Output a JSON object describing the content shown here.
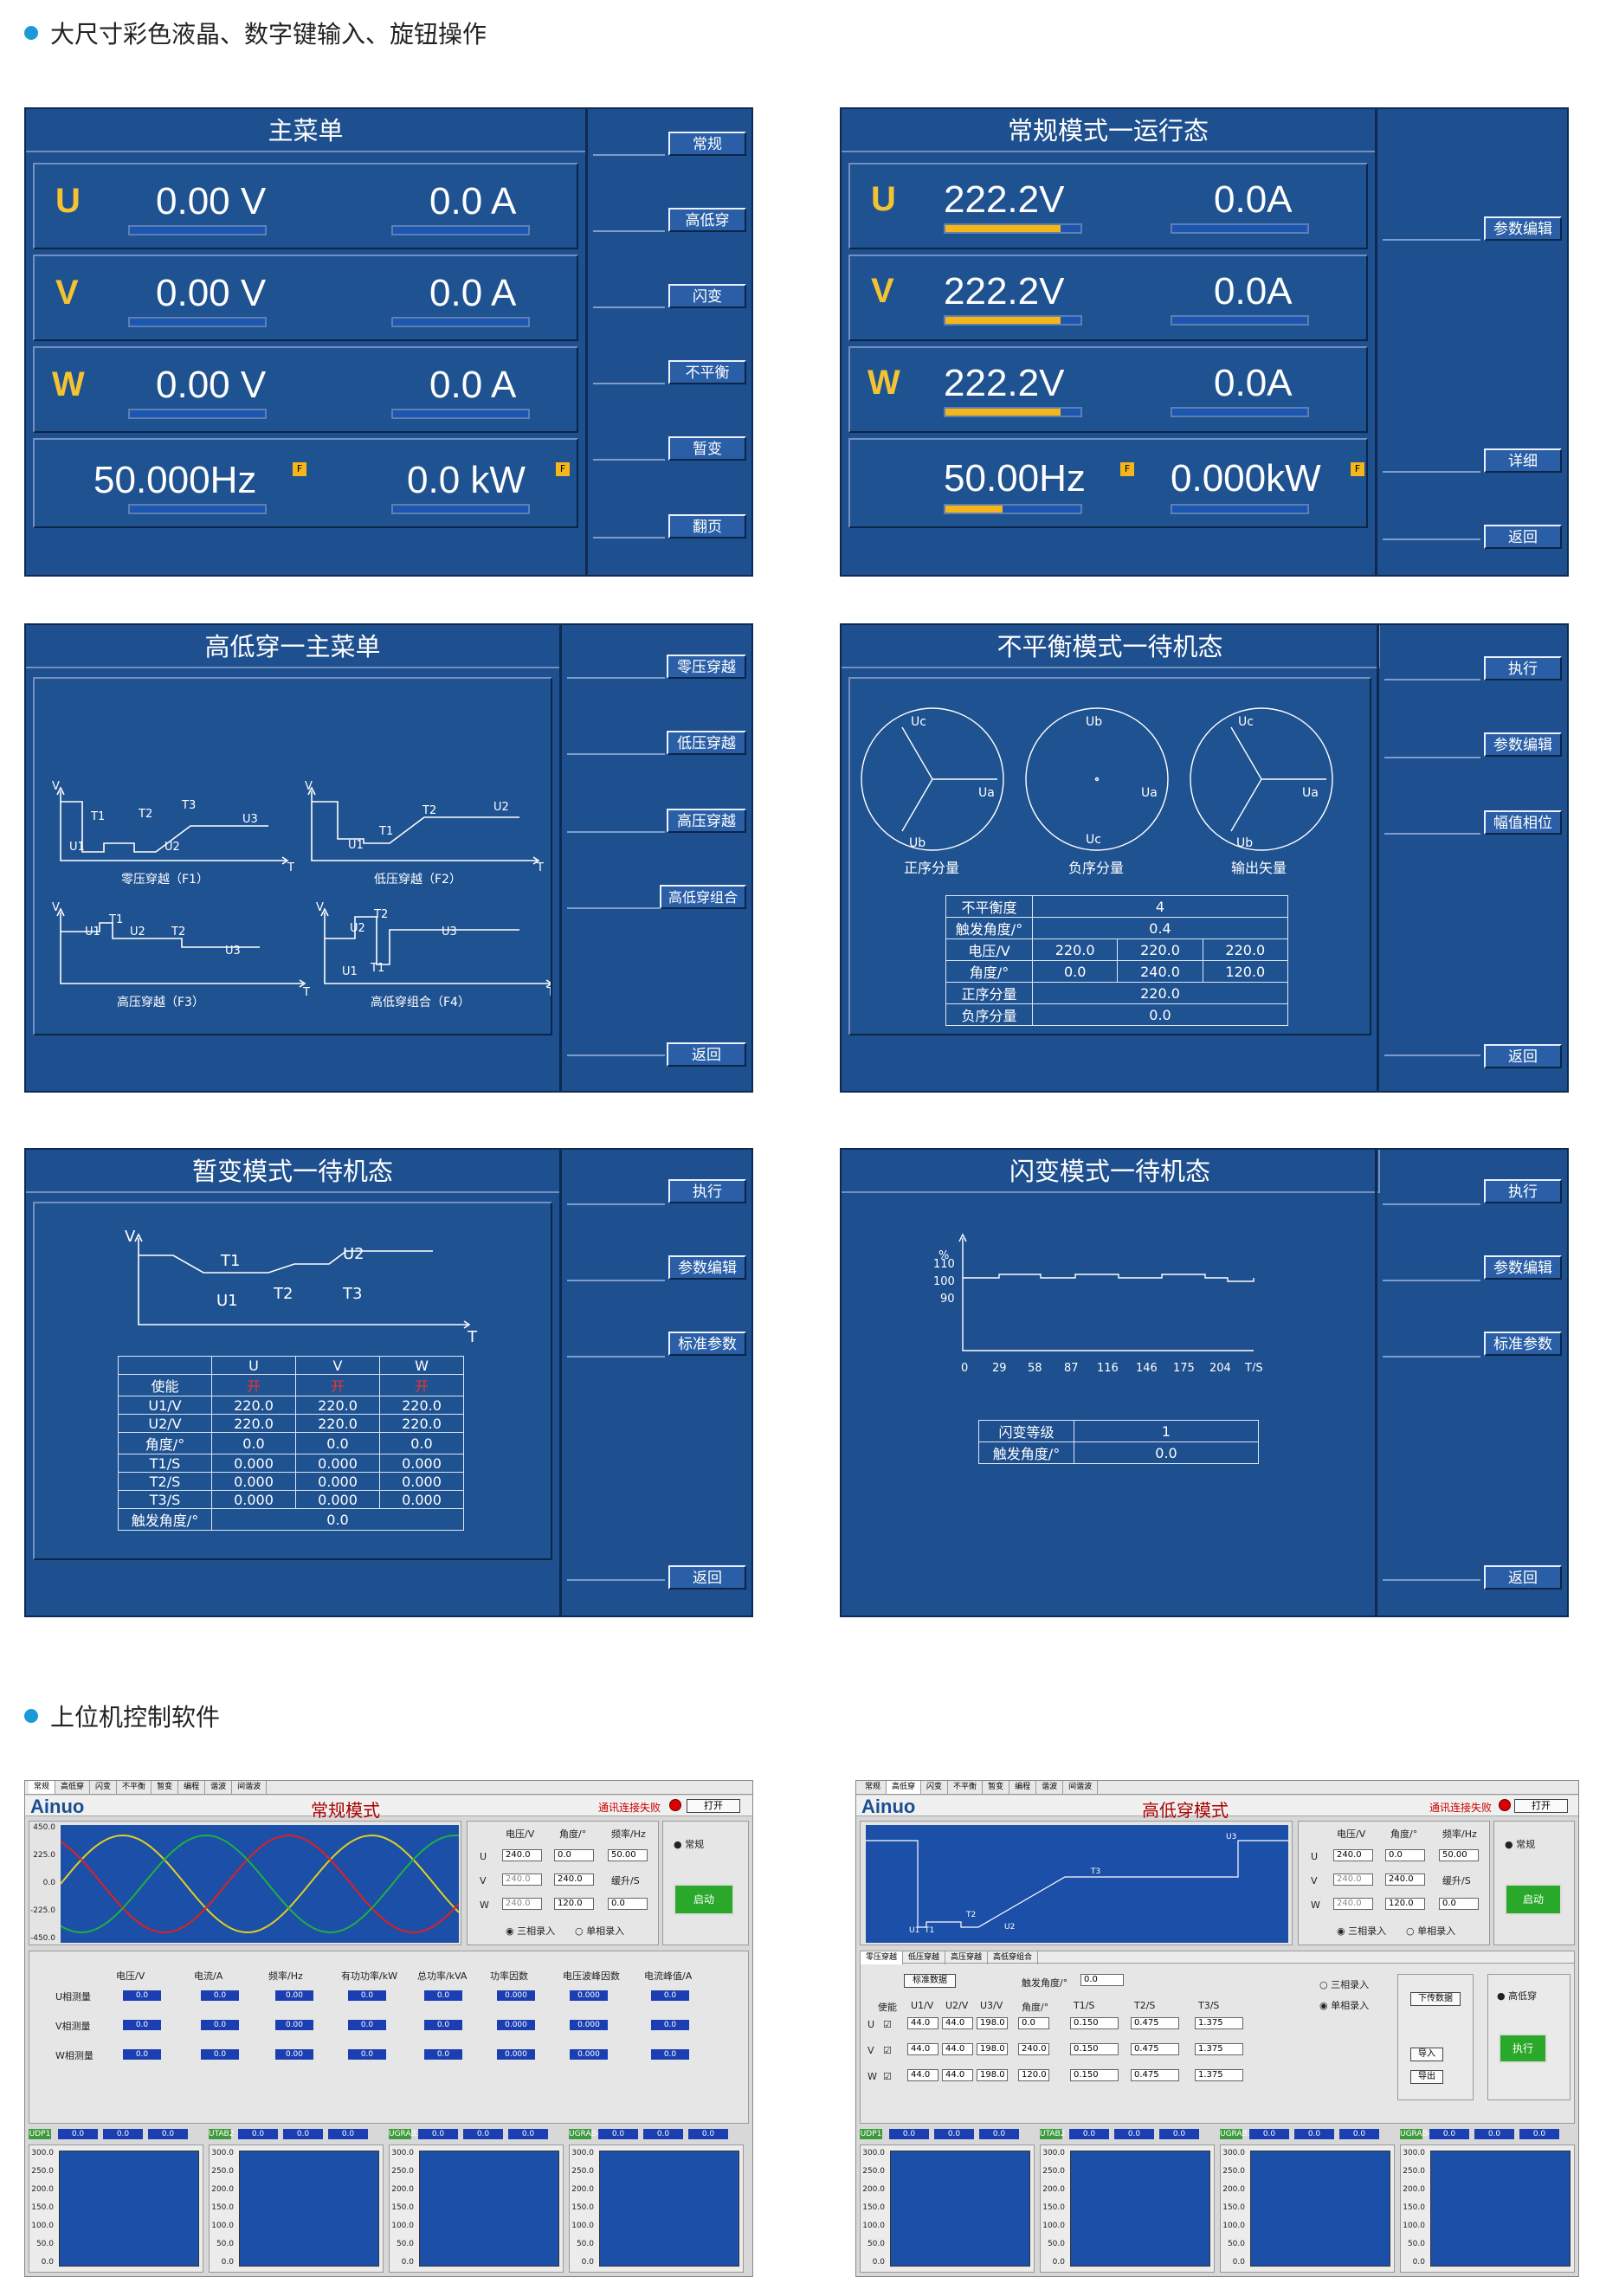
{
  "sections": {
    "s1": "大尺寸彩色液晶、数字键输入、旋钮操作",
    "s2": "上位机控制软件"
  },
  "p1": {
    "title": "主菜单",
    "buttons": [
      "常规",
      "高低穿",
      "闪变",
      "不平衡",
      "暂变",
      "翻页"
    ],
    "rows": [
      {
        "ph": "U",
        "v": "0.00 V",
        "a": "0.0 A"
      },
      {
        "ph": "V",
        "v": "0.00 V",
        "a": "0.0 A"
      },
      {
        "ph": "W",
        "v": "0.00 V",
        "a": "0.0 A"
      }
    ],
    "freq": "50.000Hz",
    "power": "0.0 kW",
    "badge": "F"
  },
  "p2": {
    "title": "常规模式一运行态",
    "buttons": [
      "参数编辑",
      "详细",
      "返回"
    ],
    "rows": [
      {
        "ph": "U",
        "v": "222.2V",
        "a": "0.0A",
        "fill": 0.85
      },
      {
        "ph": "V",
        "v": "222.2V",
        "a": "0.0A",
        "fill": 0.85
      },
      {
        "ph": "W",
        "v": "222.2V",
        "a": "0.0A",
        "fill": 0.85
      }
    ],
    "freq": "50.00Hz",
    "power": "0.000kW",
    "badge": "F",
    "freq_fill": 0.42
  },
  "p3": {
    "title": "高低穿一主菜单",
    "buttons": [
      "零压穿越",
      "低压穿越",
      "高压穿越",
      "高低穿组合",
      "返回"
    ],
    "captions": [
      "零压穿越（F1）",
      "低压穿越（F2）",
      "高压穿越（F3）",
      "高低穿组合（F4）"
    ],
    "labels": {
      "V": "V",
      "T": "T",
      "U1": "U1",
      "U2": "U2",
      "U3": "U3",
      "T1": "T1",
      "T2": "T2",
      "T3": "T3"
    }
  },
  "p4": {
    "title": "不平衡模式一待机态",
    "buttons": [
      "执行",
      "参数编辑",
      "幅值相位",
      "返回"
    ],
    "phasors": [
      {
        "top": "Uc",
        "right": "Ua",
        "bottom": "Ub",
        "caption": "正序分量"
      },
      {
        "top": "Ub",
        "right": "Ua",
        "bottom": "Uc",
        "caption": "负序分量"
      },
      {
        "top": "Uc",
        "right": "Ua",
        "bottom": "Ub",
        "caption": "输出矢量"
      }
    ],
    "table": [
      [
        "不平衡度",
        "4"
      ],
      [
        "触发角度/°",
        "0.4"
      ],
      [
        "电压/V",
        "220.0",
        "220.0",
        "220.0"
      ],
      [
        "角度/°",
        "0.0",
        "240.0",
        "120.0"
      ],
      [
        "正序分量",
        "220.0"
      ],
      [
        "负序分量",
        "0.0"
      ]
    ]
  },
  "p5": {
    "title": "暂变模式一待机态",
    "buttons": [
      "执行",
      "参数编辑",
      "标准参数",
      "返回"
    ],
    "labels": {
      "V": "V",
      "T": "T",
      "T1": "T1",
      "T2": "T2",
      "T3": "T3",
      "U1": "U1",
      "U2": "U2"
    },
    "head": [
      "",
      "U",
      "V",
      "W"
    ],
    "rows": [
      [
        "使能",
        "开",
        "开",
        "开"
      ],
      [
        "U1/V",
        "220.0",
        "220.0",
        "220.0"
      ],
      [
        "U2/V",
        "220.0",
        "220.0",
        "220.0"
      ],
      [
        "角度/°",
        "0.0",
        "0.0",
        "0.0"
      ],
      [
        "T1/S",
        "0.000",
        "0.000",
        "0.000"
      ],
      [
        "T2/S",
        "0.000",
        "0.000",
        "0.000"
      ],
      [
        "T3/S",
        "0.000",
        "0.000",
        "0.000"
      ]
    ],
    "last": [
      "触发角度/°",
      "0.0"
    ]
  },
  "p6": {
    "title": "闪变模式一待机态",
    "buttons": [
      "执行",
      "参数编辑",
      "标准参数",
      "返回"
    ],
    "y_ticks": [
      "%",
      "110",
      "100",
      "90"
    ],
    "x_ticks": [
      "0",
      "29",
      "58",
      "87",
      "116",
      "146",
      "175",
      "204",
      "T/S"
    ],
    "table": [
      [
        "闪变等级",
        "1"
      ],
      [
        "触发角度/°",
        "0.0"
      ]
    ]
  },
  "w1": {
    "tabs": [
      "常规",
      "高低穿",
      "闪变",
      "不平衡",
      "暂变",
      "编程",
      "谐波",
      "间谐波"
    ],
    "logo": "Ainuo",
    "title": "常规模式",
    "status": "通讯连接失败",
    "open": "打开",
    "y_ticks": [
      "450.0",
      "225.0",
      "0.0",
      "-225.0",
      "-450.0"
    ],
    "hdr": [
      "电压/V",
      "角度/°",
      "频率/Hz"
    ],
    "ctrl": [
      {
        "ph": "U",
        "v": "240.0",
        "a": "0.0",
        "f": "50.00"
      },
      {
        "ph": "V",
        "v": "240.0",
        "a": "240.0",
        "f_lbl": "缓升/S"
      },
      {
        "ph": "W",
        "v": "240.0",
        "a": "120.0",
        "f": "0.0"
      }
    ],
    "radio": [
      "三相录入",
      "单相录入"
    ],
    "mode": "常规",
    "start": "启动",
    "meas_head": [
      "电压/V",
      "电流/A",
      "频率/Hz",
      "有功功率/kW",
      "总功率/kVA",
      "功率因数",
      "电压波峰因数",
      "电流峰值/A"
    ],
    "meas_rows": [
      "U相测量",
      "V相测量",
      "W相测量"
    ],
    "meas_vals": [
      "0.0",
      "0.0",
      "0.00",
      "0.0",
      "0.0",
      "0.000",
      "0.000",
      "0.0"
    ],
    "strip": [
      "0.0",
      "0.0",
      "0.0",
      "0.0"
    ],
    "strip_tags": [
      "UDP1",
      "UTAB2",
      "UGRAB3",
      "UGRAB4"
    ],
    "plot_ticks": [
      "300.0",
      "250.0",
      "200.0",
      "150.0",
      "100.0",
      "50.0",
      "0.0"
    ]
  },
  "w2": {
    "tabs": [
      "常规",
      "高低穿",
      "闪变",
      "不平衡",
      "暂变",
      "编程",
      "谐波",
      "间谐波"
    ],
    "logo": "Ainuo",
    "title": "高低穿模式",
    "status": "通讯连接失败",
    "open": "打开",
    "hdr": [
      "电压/V",
      "角度/°",
      "频率/Hz"
    ],
    "ctrl": [
      {
        "ph": "U",
        "v": "240.0",
        "a": "0.0",
        "f": "50.00"
      },
      {
        "ph": "V",
        "v": "240.0",
        "a": "240.0",
        "f_lbl": "缓升/S"
      },
      {
        "ph": "W",
        "v": "240.0",
        "a": "120.0",
        "f": "0.0"
      }
    ],
    "radio": [
      "三相录入",
      "单相录入"
    ],
    "mode": "常规",
    "start": "启动",
    "subtabs": [
      "零压穿越",
      "低压穿越",
      "高压穿越",
      "高低穿组合"
    ],
    "std": "标准数据",
    "trig_lbl": "触发角度/°",
    "trig": "0.0",
    "phead": [
      "使能",
      "U1/V",
      "U2/V",
      "U3/V",
      "角度/°",
      "T1/S",
      "T2/S",
      "T3/S"
    ],
    "prows": [
      {
        "ph": "U",
        "vals": [
          "44.0",
          "44.0",
          "198.0",
          "0.0",
          "0.150",
          "0.475",
          "1.375"
        ]
      },
      {
        "ph": "V",
        "vals": [
          "44.0",
          "44.0",
          "198.0",
          "240.0",
          "0.150",
          "0.475",
          "1.375"
        ]
      },
      {
        "ph": "W",
        "vals": [
          "44.0",
          "44.0",
          "198.0",
          "120.0",
          "0.150",
          "0.475",
          "1.375"
        ]
      }
    ],
    "radio2": [
      "三相录入",
      "单相录入"
    ],
    "btns": [
      "下传数据",
      "导入",
      "导出"
    ],
    "mode2": "高低穿",
    "exec": "执行",
    "chart_labels": {
      "U3": "U3",
      "T3": "T3",
      "T2": "T2",
      "U2": "U2",
      "U1": "U1",
      "T1": "T1"
    },
    "strip": [
      "0.0",
      "0.0",
      "0.0",
      "0.0"
    ],
    "strip_tags": [
      "UDP1",
      "UTAB2",
      "UGRAB3",
      "UGRAB4"
    ],
    "plot_ticks": [
      "300.0",
      "250.0",
      "200.0",
      "150.0",
      "100.0",
      "50.0",
      "0.0"
    ]
  }
}
